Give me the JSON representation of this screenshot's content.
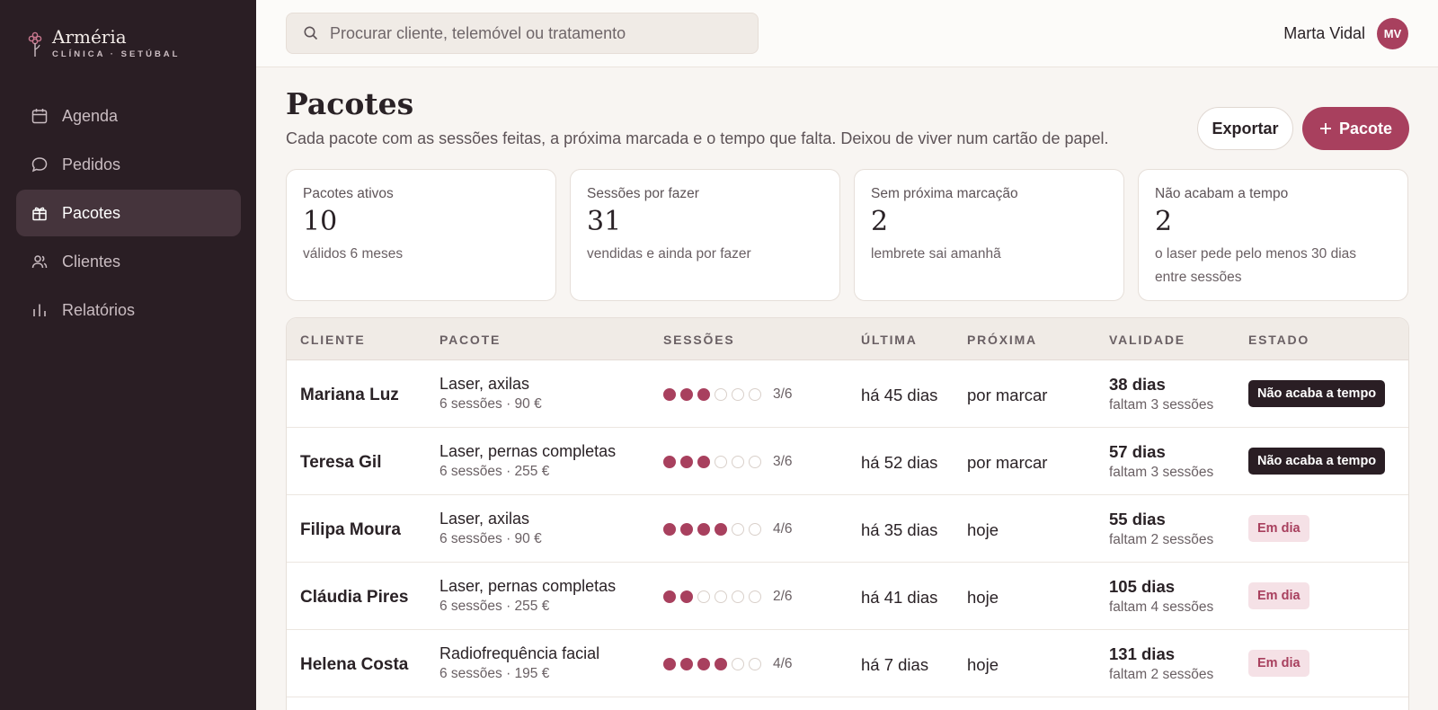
{
  "brand": {
    "name": "Arméria",
    "subtitle": "CLÍNICA · SETÚBAL"
  },
  "nav": [
    {
      "label": "Agenda",
      "icon": "calendar-icon"
    },
    {
      "label": "Pedidos",
      "icon": "chat-bubble-icon"
    },
    {
      "label": "Pacotes",
      "icon": "gift-icon",
      "active": true
    },
    {
      "label": "Clientes",
      "icon": "users-icon"
    },
    {
      "label": "Relatórios",
      "icon": "bar-chart-icon"
    }
  ],
  "search": {
    "placeholder": "Procurar cliente, telemóvel ou tratamento"
  },
  "user": {
    "name": "Marta Vidal",
    "initials": "MV"
  },
  "page": {
    "title": "Pacotes",
    "subtitle": "Cada pacote com as sessões feitas, a próxima marcada e o tempo que falta. Deixou de viver num cartão de papel.",
    "export_label": "Exportar",
    "new_label": "Pacote"
  },
  "stats": [
    {
      "label": "Pacotes ativos",
      "value": "10",
      "note": "válidos 6 meses"
    },
    {
      "label": "Sessões por fazer",
      "value": "31",
      "note": "vendidas e ainda por fazer"
    },
    {
      "label": "Sem próxima marcação",
      "value": "2",
      "note": "lembrete sai amanhã"
    },
    {
      "label": "Não acabam a tempo",
      "value": "2",
      "note": "o laser pede pelo menos 30 dias entre sessões"
    }
  ],
  "table": {
    "headers": [
      "CLIENTE",
      "PACOTE",
      "SESSÕES",
      "ÚLTIMA",
      "PRÓXIMA",
      "VALIDADE",
      "ESTADO"
    ],
    "rows": [
      {
        "cliente": "Mariana Luz",
        "pacote": "Laser, axilas",
        "pacote_sub": "6 sessões · 90 €",
        "done": 3,
        "total": 6,
        "sessoes": "3/6",
        "ultima": "há 45 dias",
        "proxima": "por marcar",
        "validade": "38 dias",
        "validade_sub": "faltam 3 sessões",
        "estado": "Não acaba a tempo",
        "estado_tipo": "dark"
      },
      {
        "cliente": "Teresa Gil",
        "pacote": "Laser, pernas completas",
        "pacote_sub": "6 sessões · 255 €",
        "done": 3,
        "total": 6,
        "sessoes": "3/6",
        "ultima": "há 52 dias",
        "proxima": "por marcar",
        "validade": "57 dias",
        "validade_sub": "faltam 3 sessões",
        "estado": "Não acaba a tempo",
        "estado_tipo": "dark"
      },
      {
        "cliente": "Filipa Moura",
        "pacote": "Laser, axilas",
        "pacote_sub": "6 sessões · 90 €",
        "done": 4,
        "total": 6,
        "sessoes": "4/6",
        "ultima": "há 35 dias",
        "proxima": "hoje",
        "validade": "55 dias",
        "validade_sub": "faltam 2 sessões",
        "estado": "Em dia",
        "estado_tipo": "light"
      },
      {
        "cliente": "Cláudia Pires",
        "pacote": "Laser, pernas completas",
        "pacote_sub": "6 sessões · 255 €",
        "done": 2,
        "total": 6,
        "sessoes": "2/6",
        "ultima": "há 41 dias",
        "proxima": "hoje",
        "validade": "105 dias",
        "validade_sub": "faltam 4 sessões",
        "estado": "Em dia",
        "estado_tipo": "light"
      },
      {
        "cliente": "Helena Costa",
        "pacote": "Radiofrequência facial",
        "pacote_sub": "6 sessões · 195 €",
        "done": 4,
        "total": 6,
        "sessoes": "4/6",
        "ultima": "há 7 dias",
        "proxima": "hoje",
        "validade": "131 dias",
        "validade_sub": "faltam 2 sessões",
        "estado": "Em dia",
        "estado_tipo": "light"
      }
    ]
  },
  "colors": {
    "sidebar": "#2a1e24",
    "accent": "#a8405e",
    "background": "#f8f5f2"
  }
}
